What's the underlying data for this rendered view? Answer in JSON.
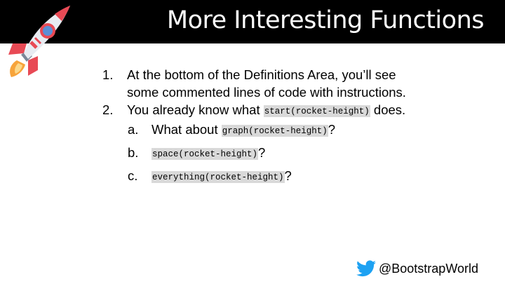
{
  "slide": {
    "title": "More Interesting Functions",
    "items": [
      {
        "number": "1.",
        "line1": "At the bottom of the Definitions Area, you’ll see",
        "line2": "some commented lines of code with instructions."
      },
      {
        "number": "2.",
        "before": "You already know what ",
        "code": "start(rocket-height)",
        "after": " does."
      }
    ],
    "subitems": [
      {
        "letter": "a.",
        "before": "What about ",
        "code": "graph(rocket-height)",
        "after": "?"
      },
      {
        "letter": "b.",
        "before": "",
        "code": "space(rocket-height)",
        "after": "?"
      },
      {
        "letter": "c.",
        "before": "",
        "code": "everything(rocket-height)",
        "after": "?"
      }
    ]
  },
  "footer": {
    "icon": "twitter-bird-icon",
    "handle": "@BootstrapWorld"
  },
  "colors": {
    "title_bar": "#000000",
    "title_text": "#ffffff",
    "code_background": "#d9d9d9",
    "twitter_blue": "#1da1f2",
    "rocket_red": "#e84a55",
    "rocket_flame": "#f7a43b"
  }
}
